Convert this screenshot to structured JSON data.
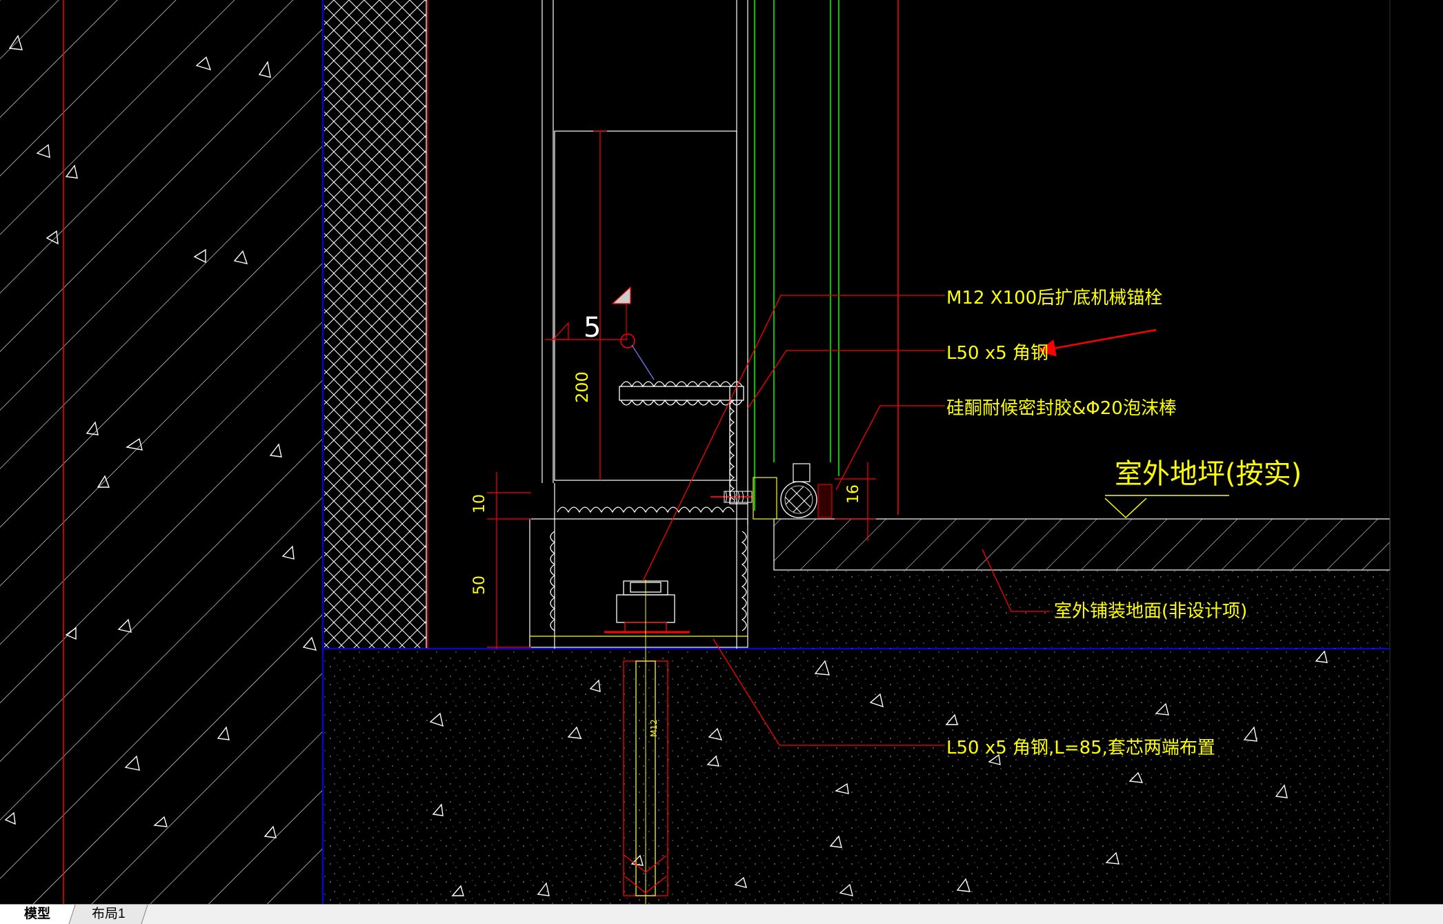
{
  "annotations": {
    "anchor_bolt": "M12 X100后扩底机械锚栓",
    "angle_steel": "L50 x5 角钢",
    "sealant": "硅酮耐候密封胶&Φ20泡沫棒",
    "outdoor_grade": "室外地坪(按实)",
    "outdoor_paving": "室外铺装地面(非设计项)",
    "angle_steel_sleeve": "L50 x5 角钢,L=85,套芯两端布置"
  },
  "dimensions": {
    "d200": "200",
    "d10": "10",
    "d50": "50",
    "d16": "16",
    "weld_size": "5",
    "bolt_label": "M12"
  },
  "tabs": [
    {
      "label": "模型",
      "active": true
    },
    {
      "label": "布局1",
      "active": false
    }
  ],
  "colors": {
    "background": "#000000",
    "annotation_text": "#ffff00",
    "leader_line": "#ff0000",
    "glass_frame": "#00ff00",
    "wall_boundary": "#0000ff",
    "section_lines": "#ffffff"
  }
}
